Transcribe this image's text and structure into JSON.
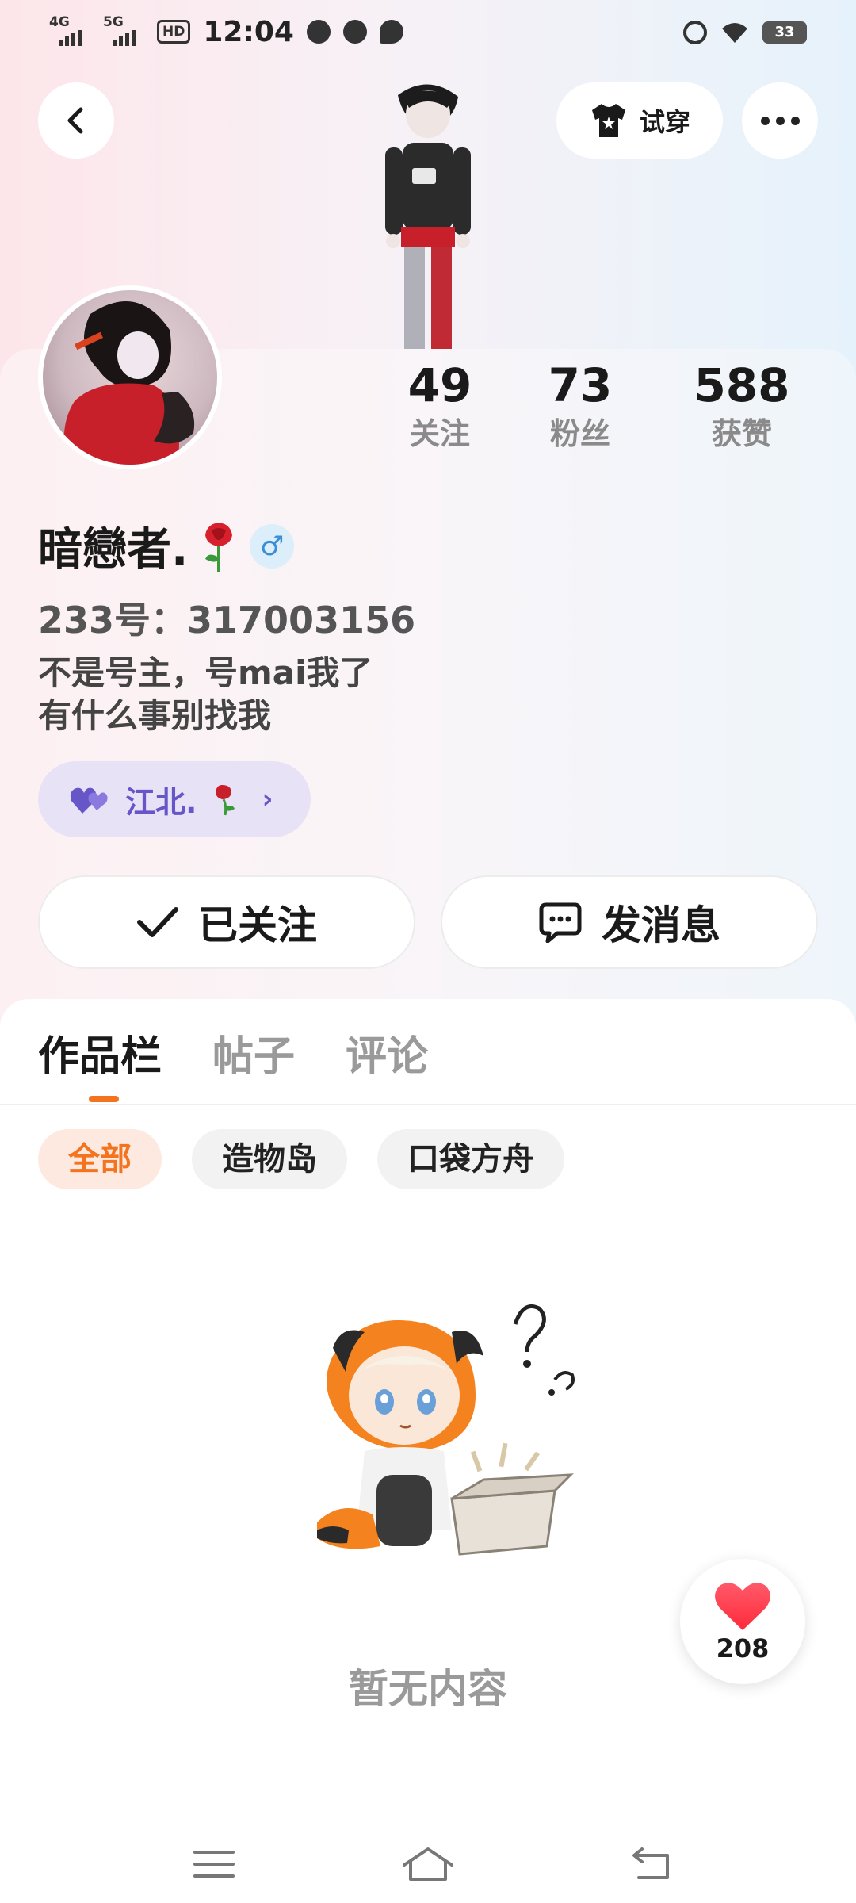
{
  "status_bar": {
    "net1": "4G",
    "net2": "5G",
    "hd": "HD",
    "time": "12:04",
    "battery": "33"
  },
  "header": {
    "tryon_label": "试穿"
  },
  "profile": {
    "stats": [
      {
        "value": "49",
        "label": "关注"
      },
      {
        "value": "73",
        "label": "粉丝"
      },
      {
        "value": "588",
        "label": "获赞"
      }
    ],
    "username": "暗戀者.",
    "gender_symbol": "♂",
    "user_id": "233号：317003156",
    "bio_lines": [
      "不是号主，号mai我了",
      "有什么事别找我"
    ],
    "tag_label": "江北.",
    "follow_label": "已关注",
    "message_label": "发消息"
  },
  "tabs": [
    {
      "label": "作品栏",
      "active": true
    },
    {
      "label": "帖子",
      "active": false
    },
    {
      "label": "评论",
      "active": false
    }
  ],
  "filters": [
    {
      "label": "全部",
      "active": true
    },
    {
      "label": "造物岛",
      "active": false
    },
    {
      "label": "口袋方舟",
      "active": false
    }
  ],
  "empty_text": "暂无内容",
  "like_fab": {
    "count": "208"
  },
  "colors": {
    "accent": "#f4731f",
    "tag_purple": "#6656c8",
    "like_red": "#ff3b4a"
  }
}
